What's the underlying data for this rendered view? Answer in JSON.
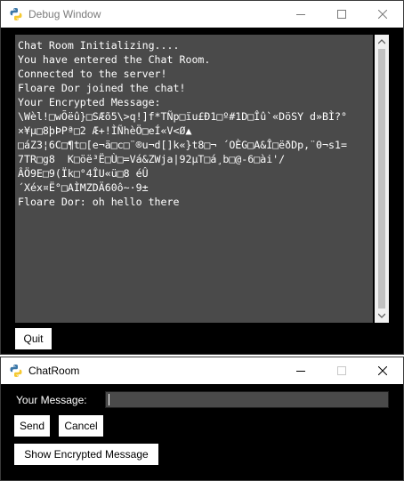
{
  "debug_window": {
    "title": "Debug Window",
    "output_lines": [
      "Chat Room Initializing....",
      "You have entered the Chat Room.",
      "Connected to the server!",
      "Floare Dor joined the chat!",
      "Your Encrypted Message:",
      "\\Wèl!□wÕëû}□SÆõ5\\>q!]f*TÑp□ïu£Ð1□º#1D□Îû`«DöSY d»BÌ?°",
      "×¥µ□8þÞPª□2 Æ+!ÌÑhèÖ□eÍ«V<Ø▲",
      "□áZ3¦6C□¶t□[e¬ä□c□¨®u¬d[]k«}t8□¬ ´OÈG□A&Î□ëðDp,¨0¬s1=",
      "7TR□g8  K□öë³Ë□Ù□=Vá&ZWja|92µT□á¸b□@-6□ài'/",
      "ÂÖ9E□9(Ïk□°4ÎU«ü□8 éÛ",
      "´Xéx¤Ë°□AÌMZDÄ60ô~·9±",
      "Floare Dor: oh hello there"
    ],
    "quit_label": "Quit"
  },
  "chat_window": {
    "title": "ChatRoom",
    "message_label": "Your Message:",
    "message_value": "",
    "send_label": "Send",
    "cancel_label": "Cancel",
    "show_encrypted_label": "Show Encrypted Message"
  },
  "colors": {
    "window_bg": "#000000",
    "output_bg": "#4a4a4a",
    "text": "#ffffff",
    "titlebar": "#ffffff"
  },
  "icons": [
    "python-logo-icon",
    "minimize-icon",
    "maximize-icon",
    "close-icon",
    "scroll-up-arrow-icon",
    "scroll-down-arrow-icon"
  ]
}
